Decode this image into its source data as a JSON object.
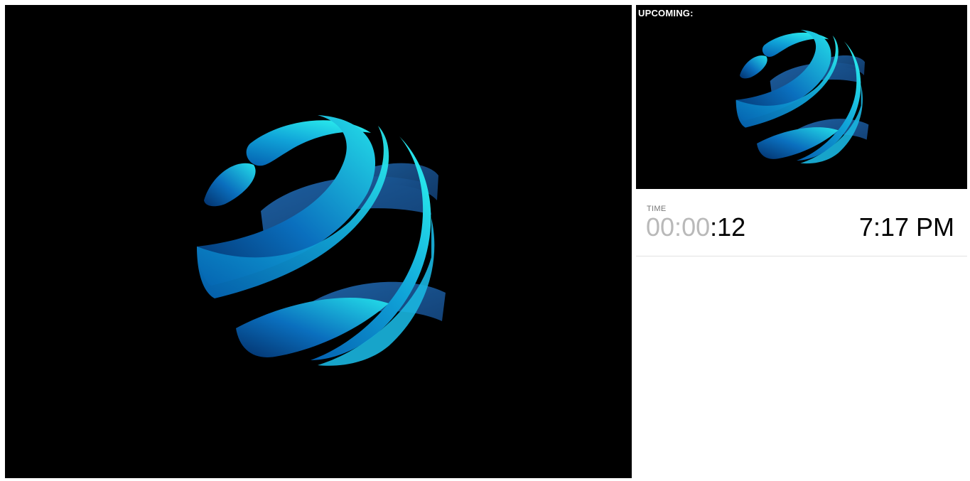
{
  "preview": {
    "label": "UPCOMING:"
  },
  "timer": {
    "label": "TIME",
    "hours": "00",
    "sep1": ":",
    "minutes": "00",
    "sep2": ":",
    "seconds": "12"
  },
  "clock": {
    "time": "7:17 PM"
  },
  "colors": {
    "background": "#000000",
    "logo_light": "#22dbe8",
    "logo_mid": "#0f8fd0",
    "logo_dark": "#0a3f7e",
    "timer_dim": "#b9b9b9"
  },
  "icons": {
    "logo": "striped-globe-logo-icon"
  }
}
